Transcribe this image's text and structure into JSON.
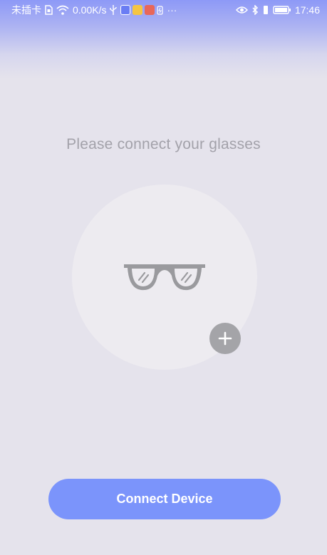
{
  "status_bar": {
    "carrier": "未插卡",
    "net_speed": "0.00K/s",
    "more": "···",
    "time": "17:46",
    "icons": [
      "sim-icon",
      "wifi-icon",
      "usb-icon",
      "app-notification-icons",
      "eye-icon",
      "bluetooth-icon",
      "vibrate-icon",
      "battery-icon"
    ]
  },
  "main": {
    "prompt": "Please connect your glasses",
    "device_icon": "glasses-icon",
    "add_icon": "plus-icon"
  },
  "footer": {
    "connect_label": "Connect Device"
  },
  "colors": {
    "background": "#e5e3ec",
    "accent": "#7b94fb",
    "circle": "#edebf0",
    "add_button": "#a4a4a8",
    "glasses": "#9a9a9e"
  }
}
